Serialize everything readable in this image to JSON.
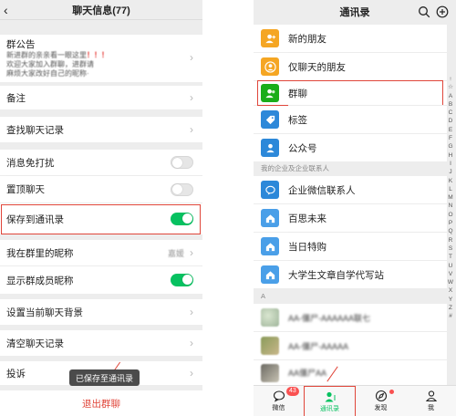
{
  "left": {
    "header": {
      "title": "聊天信息(77)",
      "back": "‹"
    },
    "notice": {
      "label": "群公告",
      "line1": "新进群的亲亲看一眼这里",
      "bangs": "！！！",
      "line2": "欢迎大家加入群聊，进群请",
      "line3": "麻烦大家改好自己的昵称·"
    },
    "rows": {
      "remark": "备注",
      "search_history": "查找聊天记录",
      "mute": "消息免打扰",
      "sticky": "置顶聊天",
      "save_contacts": "保存到通讯录",
      "my_nickname": "我在群里的昵称",
      "my_nickname_value": "嘉媛",
      "show_nicknames": "显示群成员昵称",
      "set_background": "设置当前聊天背景",
      "clear_history": "清空聊天记录",
      "report": "投诉"
    },
    "toggles": {
      "mute": false,
      "sticky": false,
      "save_contacts": true,
      "show_nicknames": true
    },
    "toast": "已保存至通讯录",
    "exit": "退出群聊"
  },
  "right": {
    "header": {
      "title": "通讯录"
    },
    "items": {
      "new_friends": "新的朋友",
      "chat_only": "仅聊天的朋友",
      "group_chats": "群聊",
      "tags": "标签",
      "official": "公众号"
    },
    "enterprise_section": "我的企业及企业联系人",
    "enterprise": {
      "wecom": "企业微信联系人",
      "baisi": "百思未来",
      "dangri": "当日特购",
      "daxuesheng": "大学生文章自学代写站"
    },
    "section_a": "A",
    "contacts_a": [
      "AA-僵尸-AAAAAA联七",
      "AA-僵尸-AAAAA",
      "AA僵尸AA"
    ],
    "alphabet": [
      "↑",
      "☆",
      "A",
      "B",
      "C",
      "D",
      "E",
      "F",
      "G",
      "H",
      "I",
      "J",
      "K",
      "L",
      "M",
      "N",
      "O",
      "P",
      "Q",
      "R",
      "S",
      "T",
      "U",
      "V",
      "W",
      "X",
      "Y",
      "Z",
      "#"
    ],
    "tabs": {
      "chats": "微信",
      "contacts": "通讯录",
      "discover": "发现",
      "me": "我"
    },
    "chats_badge": "43",
    "colors": {
      "accent": "#07c160",
      "highlight": "#e0463a",
      "orange": "#f5a623",
      "blue": "#2c88d9",
      "green": "#1aad19"
    }
  }
}
